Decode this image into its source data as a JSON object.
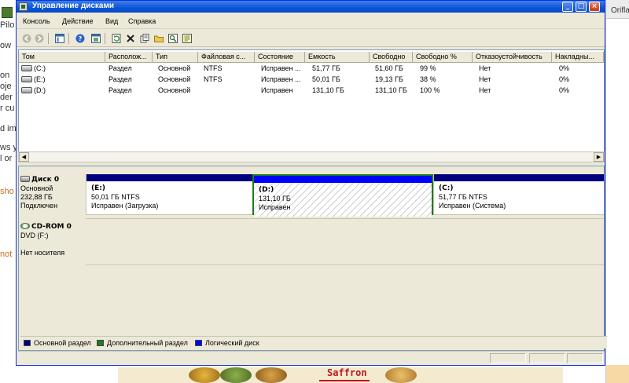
{
  "background": {
    "left_fragments": [
      "Pilo",
      "ow",
      "oje",
      "der",
      "r cu",
      "on",
      "d im",
      "ws y",
      "l or",
      "sho",
      "not"
    ],
    "right_tab_label": "Oriflar",
    "bottom_banner_text": "Saffron"
  },
  "window": {
    "title": "Управление дисками",
    "buttons": {
      "minimize": "_",
      "maximize": "□",
      "close": "×"
    }
  },
  "menu": {
    "items": [
      "Консоль",
      "Действие",
      "Вид",
      "Справка"
    ]
  },
  "toolbar": {
    "icons": [
      "back-icon",
      "forward-icon",
      "console-tree-icon",
      "help-icon",
      "window-icon",
      "refresh-icon",
      "delete-icon",
      "properties-icon",
      "open-icon",
      "search-icon",
      "export-icon"
    ]
  },
  "volume_list": {
    "columns": [
      "Том",
      "Располож...",
      "Тип",
      "Файловая с...",
      "Состояние",
      "Емкость",
      "Свободно",
      "Свободно %",
      "Отказоустойчивость",
      "Накладны..."
    ],
    "rows": [
      [
        "(C:)",
        "Раздел",
        "Основной",
        "NTFS",
        "Исправен ...",
        "51,77 ГБ",
        "51,60 ГБ",
        "99 %",
        "Нет",
        "0%"
      ],
      [
        "(E:)",
        "Раздел",
        "Основной",
        "NTFS",
        "Исправен ...",
        "50,01 ГБ",
        "19,13 ГБ",
        "38 %",
        "Нет",
        "0%"
      ],
      [
        "(D:)",
        "Раздел",
        "Основной",
        "",
        "Исправен",
        "131,10 ГБ",
        "131,10 ГБ",
        "100 %",
        "Нет",
        "0%"
      ]
    ]
  },
  "disks": [
    {
      "name": "Диск 0",
      "type": "Основной",
      "size": "232,88 ГБ",
      "status": "Подключен",
      "partitions": [
        {
          "label": "(E:)",
          "size_fs": "50,01 ГБ NTFS",
          "status": "Исправен (Загрузка)",
          "bar_color": "#00007f",
          "selected": false
        },
        {
          "label": "(D:)",
          "size_fs": "131,10 ГБ",
          "status": "Исправен",
          "bar_color": "#0000ff",
          "selected": true
        },
        {
          "label": "(C:)",
          "size_fs": "51,77 ГБ NTFS",
          "status": "Исправен (Система)",
          "bar_color": "#00007f",
          "selected": false
        }
      ]
    },
    {
      "name": "CD-ROM 0",
      "type": "DVD (F:)",
      "status": "Нет носителя"
    }
  ],
  "legend": {
    "items": [
      {
        "label": "Основной раздел",
        "color": "#00007f"
      },
      {
        "label": "Дополнительный раздел",
        "color": "#1c7d1c"
      },
      {
        "label": "Логический диск",
        "color": "#0000ff"
      }
    ]
  }
}
